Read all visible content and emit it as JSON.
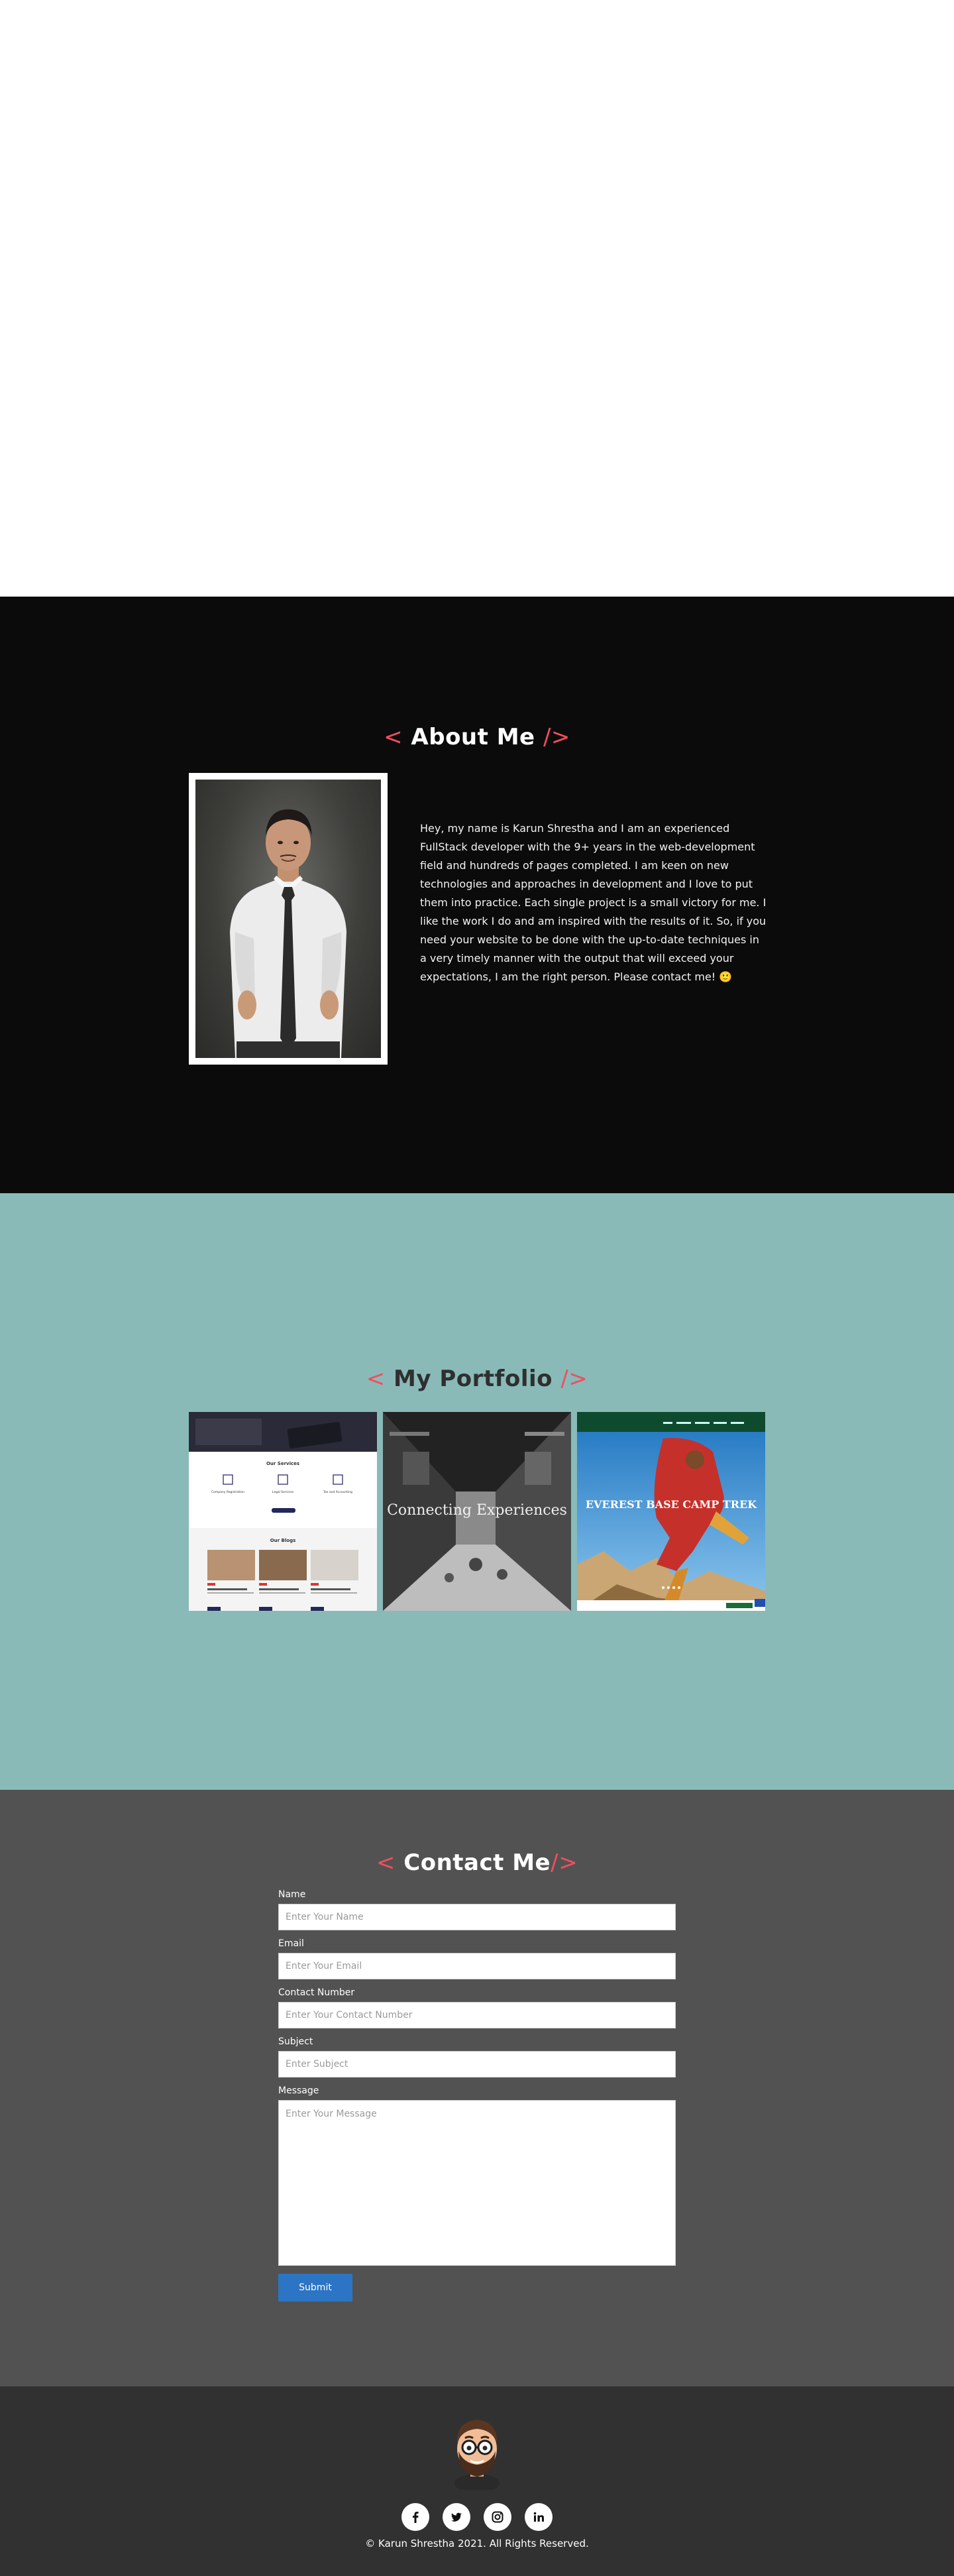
{
  "about": {
    "title_open": "<",
    "title": "About Me",
    "title_close": "/>",
    "bio": "Hey, my name is Karun Shrestha and I am an experienced FullStack developer with the 9+ years in the web-development field and hundreds of pages completed. I am keen on new technologies and approaches in development and I love to put them into practice. Each single project is a small victory for me. I like the work I do and am inspired with the results of it. So, if you need your website to be done with the up-to-date techniques in a very timely manner with the output that will exceed your expectations, I am the right person. Please contact me! 🙂"
  },
  "portfolio": {
    "title_open": "<",
    "title": "My Portfolio",
    "title_close": "/>",
    "items": [
      {
        "heading_1": "Our Services",
        "heading_2": "Our Blogs",
        "service_1": "Company Registration",
        "service_2": "Legal Services",
        "service_3": "Tax and Accounting"
      },
      {
        "overlay": "Connecting Experiences"
      },
      {
        "overlay": "EVEREST BASE CAMP TREK"
      }
    ]
  },
  "contact": {
    "title_open": "<",
    "title": "Contact Me",
    "title_close": "/>",
    "fields": {
      "name": {
        "label": "Name",
        "placeholder": "Enter Your Name"
      },
      "email": {
        "label": "Email",
        "placeholder": "Enter Your Email"
      },
      "phone": {
        "label": "Contact Number",
        "placeholder": "Enter Your Contact Number"
      },
      "subject": {
        "label": "Subject",
        "placeholder": "Enter Subject"
      },
      "message": {
        "label": "Message",
        "placeholder": "Enter Your Message"
      }
    },
    "submit_label": "Submit"
  },
  "footer": {
    "copyright": "© Karun Shrestha 2021. All Rights Reserved.",
    "socials": [
      {
        "icon": "facebook-icon",
        "glyph": "f"
      },
      {
        "icon": "twitter-icon",
        "glyph": "t"
      },
      {
        "icon": "instagram-icon",
        "glyph": "ig"
      },
      {
        "icon": "linkedin-icon",
        "glyph": "in"
      }
    ]
  },
  "colors": {
    "accent": "#ef4f5f",
    "about_bg": "#0b0b0b",
    "portfolio_bg": "#89bab8",
    "contact_bg": "#525252",
    "footer_bg": "#313131",
    "submit_bg": "#2c74c4"
  }
}
